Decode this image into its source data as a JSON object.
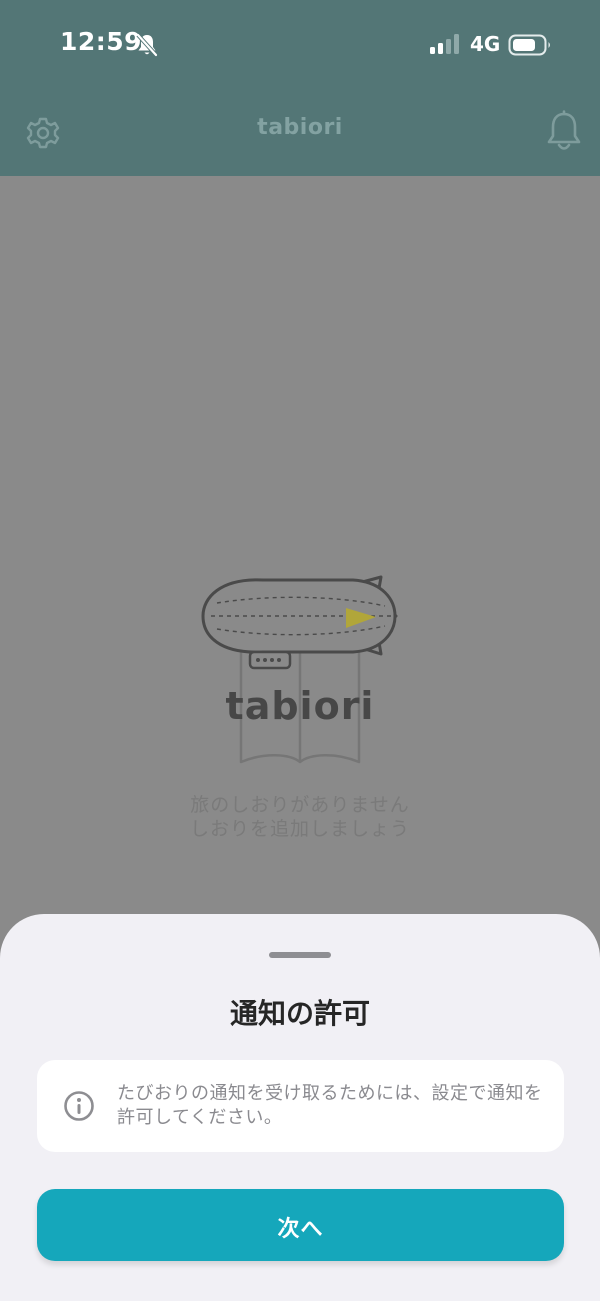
{
  "status_bar": {
    "time": "12:59",
    "network": "4G"
  },
  "header": {
    "title": "tabiori"
  },
  "empty_state": {
    "wordmark": "tabiori",
    "line1": "旅のしおりがありません",
    "line2": "しおりを追加しましょう"
  },
  "sheet": {
    "title": "通知の許可",
    "info_text": "たびおりの通知を受け取るためには、設定で通知を許可してください。",
    "next_label": "次へ"
  },
  "colors": {
    "header_bg": "#537676",
    "overlay_bg": "#8a8a8a",
    "sheet_bg": "#f1f0f5",
    "accent": "#15a7bb",
    "airship_flag": "#b1a63a"
  },
  "icons": {
    "status_silent": "bell-slash-icon",
    "signal": "cellular-signal-icon",
    "battery": "battery-icon",
    "settings": "gear-icon",
    "notifications": "bell-icon",
    "info": "info-circle-icon"
  }
}
